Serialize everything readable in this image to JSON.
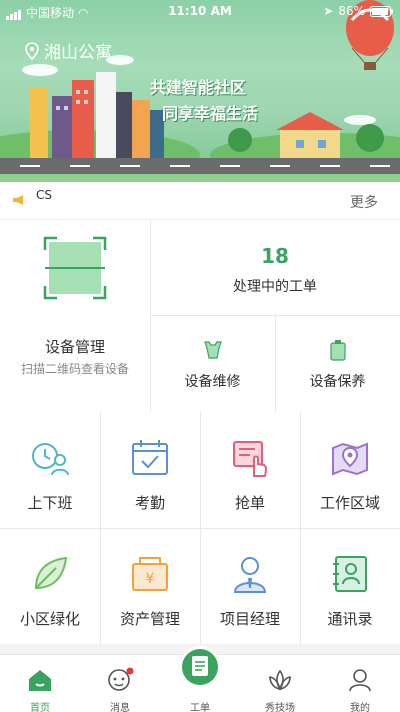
{
  "status_bar": {
    "carrier": "中国移动",
    "time": "11:10 AM",
    "battery": "86%"
  },
  "banner": {
    "location": "湘山公寓",
    "slogan_line1": "共建智能社区",
    "slogan_line2": "同享幸福生活"
  },
  "notice": {
    "text": "CS",
    "more": "更多"
  },
  "panel": {
    "device_title": "设备管理",
    "device_sub": "扫描二维码查看设备",
    "work_count": "18",
    "work_label": "处理中的工单",
    "repair_label": "设备维修",
    "maintain_label": "设备保养"
  },
  "grid": [
    {
      "label": "上下班",
      "icon": "clock-person-icon"
    },
    {
      "label": "考勤",
      "icon": "calendar-check-icon"
    },
    {
      "label": "抢单",
      "icon": "grab-order-icon"
    },
    {
      "label": "工作区域",
      "icon": "map-pin-icon"
    },
    {
      "label": "小区绿化",
      "icon": "leaf-icon"
    },
    {
      "label": "资产管理",
      "icon": "asset-yuan-icon"
    },
    {
      "label": "项目经理",
      "icon": "manager-icon"
    },
    {
      "label": "通讯录",
      "icon": "contacts-icon"
    }
  ],
  "tabs": [
    {
      "label": "首页"
    },
    {
      "label": "消息"
    },
    {
      "label": "工单"
    },
    {
      "label": "秀技场"
    },
    {
      "label": "我的"
    }
  ],
  "colors": {
    "accent": "#3aa35e",
    "banner": "#9ed6b2"
  }
}
